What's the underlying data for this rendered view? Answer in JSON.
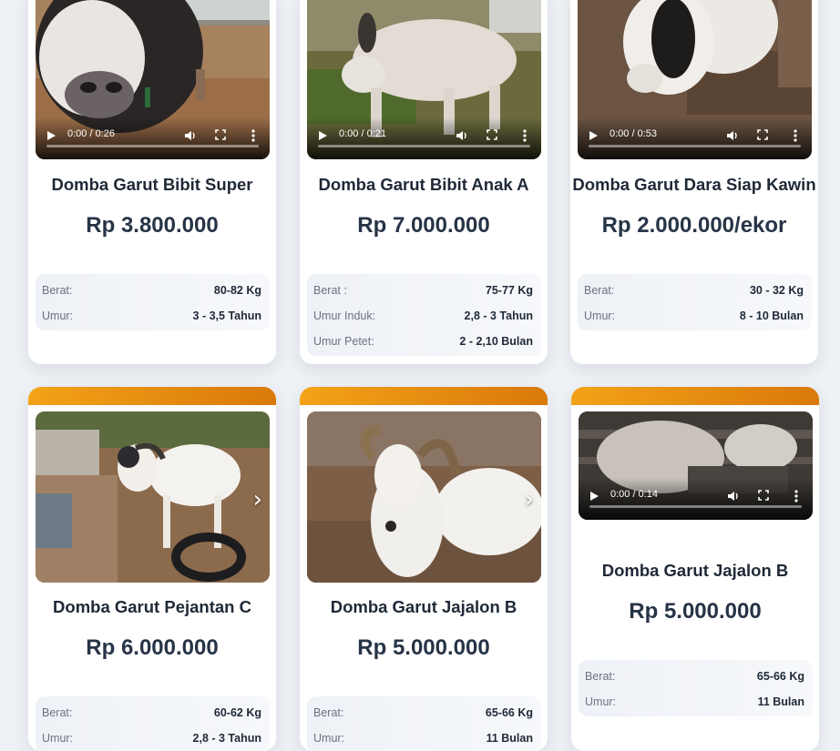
{
  "products": [
    {
      "title": "Domba Garut Bibit Super",
      "price": "Rp 3.800.000",
      "media": "video",
      "time": "0:00 / 0:26",
      "specs": [
        {
          "label": "Berat:",
          "value": "80-82 Kg"
        },
        {
          "label": "Umur:",
          "value": "3 - 3,5 Tahun"
        }
      ]
    },
    {
      "title": "Domba Garut Bibit Anak A",
      "price": "Rp 7.000.000",
      "media": "video",
      "time": "0:00 / 0:21",
      "specs": [
        {
          "label": "Berat :",
          "value": "75-77 Kg"
        },
        {
          "label": "Umur Induk:",
          "value": "2,8 - 3 Tahun"
        },
        {
          "label": "Umur Petet:",
          "value": "2 - 2,10 Bulan"
        }
      ]
    },
    {
      "title": "Domba Garut Dara Siap Kawin",
      "price": "Rp 2.000.000/ekor",
      "media": "video",
      "time": "0:00 / 0:53",
      "specs": [
        {
          "label": "Berat:",
          "value": "30 - 32 Kg"
        },
        {
          "label": "Umur:",
          "value": "8 - 10 Bulan"
        }
      ]
    },
    {
      "title": "Domba Garut Pejantan C",
      "price": "Rp 6.000.000",
      "media": "photo",
      "next_icon": "›",
      "specs": [
        {
          "label": "Berat:",
          "value": "60-62 Kg"
        },
        {
          "label": "Umur:",
          "value": "2,8 - 3 Tahun"
        }
      ]
    },
    {
      "title": "Domba Garut Jajalon B",
      "price": "Rp 5.000.000",
      "media": "photo",
      "next_icon": "›",
      "specs": [
        {
          "label": "Berat:",
          "value": "65-66 Kg"
        },
        {
          "label": "Umur:",
          "value": "11 Bulan"
        }
      ]
    },
    {
      "title": "Domba Garut Jajalon B",
      "price": "Rp 5.000.000",
      "media": "video",
      "time": "0:00 / 0:14",
      "specs": [
        {
          "label": "Berat:",
          "value": "65-66 Kg"
        },
        {
          "label": "Umur:",
          "value": "11 Bulan"
        }
      ]
    }
  ],
  "colors": {
    "accent": "#f3a218",
    "accent_dark": "#d9790a",
    "text": "#1f2937",
    "price": "#273447"
  }
}
